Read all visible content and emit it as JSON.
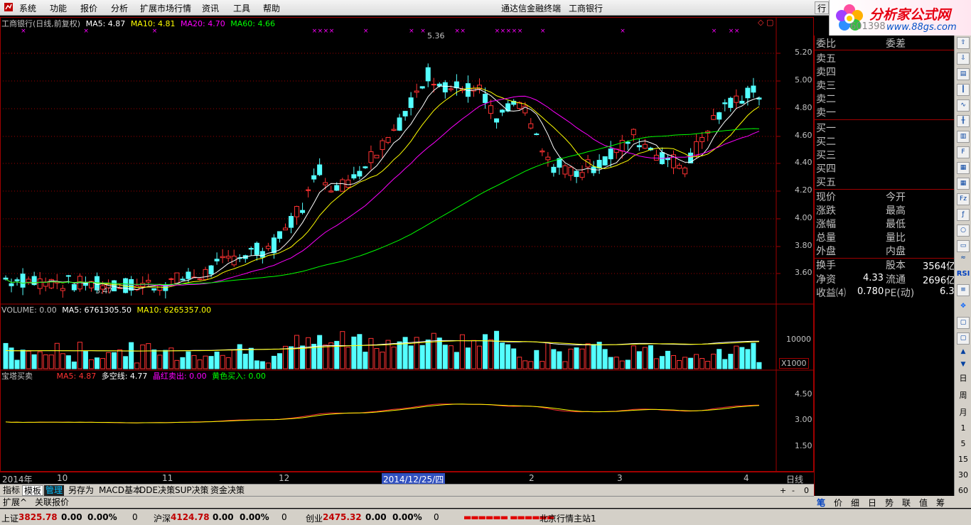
{
  "menu": [
    "系统",
    "功能",
    "报价",
    "分析",
    "扩展市场行情",
    "资讯",
    "工具",
    "帮助"
  ],
  "window_title": "通达信金融终端",
  "window_stock": "工商银行",
  "top_right_tab": "行",
  "logo": {
    "title": "分析家公式网",
    "url": "www.88gs.com"
  },
  "main_legend": {
    "title": "工商银行(日线,前复权)",
    "ma5": "MA5: 4.87",
    "ma10": "MA10: 4.81",
    "ma20": "MA20: 4.70",
    "ma60": "MA60: 4.66"
  },
  "main_annotations": {
    "high": "5.36",
    "low": "3.47"
  },
  "price_axis": [
    "5.20",
    "5.00",
    "4.80",
    "4.60",
    "4.40",
    "4.20",
    "4.00",
    "3.80",
    "3.60"
  ],
  "volume_legend": {
    "title": "VOLUME: 0.00",
    "ma5": "MA5: 6761305.50",
    "ma10": "MA10: 6265357.00"
  },
  "volume_axis": {
    "top": "10000",
    "unit": "X1000"
  },
  "indicator_legend": {
    "title": "宝塔买卖",
    "ma5": "MA5: 4.87",
    "duokong": "多空线: 4.77",
    "jinghong": "晶红卖出: 0.00",
    "huangse": "黄色买入: 0.00"
  },
  "indicator_axis": [
    "4.50",
    "3.00",
    "1.50"
  ],
  "date_axis": {
    "labels": [
      {
        "text": "2014年"
      },
      {
        "text": "10"
      },
      {
        "text": "11"
      },
      {
        "text": "12"
      },
      {
        "text": "2014/12/25/四"
      },
      {
        "text": "2"
      },
      {
        "text": "3"
      },
      {
        "text": "4"
      }
    ],
    "period": "日线"
  },
  "tabs": [
    "指标",
    "模板",
    "管理",
    "另存为",
    "MACD基本",
    "DDE决策",
    "SUP决策",
    "资金决策"
  ],
  "tabs_active": "模板",
  "tabs_dark": "管理",
  "row2": [
    "扩展^",
    "关联报价"
  ],
  "zoom_buttons": [
    "+",
    "-",
    "0"
  ],
  "right_panel": {
    "code_partial": "601398",
    "rows_top": [
      {
        "l": "委比",
        "m": "委差"
      }
    ],
    "sell": [
      "卖五",
      "卖四",
      "卖三",
      "卖二",
      "卖一"
    ],
    "buy": [
      "买一",
      "买二",
      "买三",
      "买四",
      "买五"
    ],
    "quote": [
      {
        "l": "现价",
        "m": "今开"
      },
      {
        "l": "涨跌",
        "m": "最高"
      },
      {
        "l": "涨幅",
        "m": "最低"
      },
      {
        "l": "总量",
        "m": "量比"
      },
      {
        "l": "外盘",
        "m": "内盘"
      }
    ],
    "fin": [
      {
        "l": "换手",
        "lv": "",
        "m": "股本",
        "mv": "3564亿"
      },
      {
        "l": "净资",
        "lv": "4.33",
        "m": "流通",
        "mv": "2696亿"
      },
      {
        "l": "收益⑷",
        "lv": "0.780",
        "m": "PE(动)",
        "mv": "6.3"
      }
    ]
  },
  "right_toolbar_text": [
    "RSI",
    "日",
    "周",
    "月",
    "1",
    "5",
    "15",
    "30",
    "60"
  ],
  "bottom_right_tabs": [
    "笔",
    "价",
    "细",
    "日",
    "势",
    "联",
    "值",
    "筹"
  ],
  "status": {
    "sh_label": "上证",
    "sh_val": "3825.78",
    "sh_chg": "0.00",
    "sh_pct": "0.00%",
    "sh_amt": "0",
    "hs_label": "沪深",
    "hs_val": "4124.78",
    "hs_chg": "0.00",
    "hs_pct": "0.00%",
    "hs_amt": "0",
    "cy_label": "创业",
    "cy_val": "2475.32",
    "cy_chg": "0.00",
    "cy_pct": "0.00%",
    "cy_amt": "0",
    "server": "北京行情主站1"
  },
  "colors": {
    "up": "#ff3232",
    "down": "#54ffff",
    "ma5": "#ffffff",
    "ma10": "#ffff00",
    "ma20": "#ff00ff",
    "ma60": "#00ff00",
    "grid": "#a00000"
  }
}
